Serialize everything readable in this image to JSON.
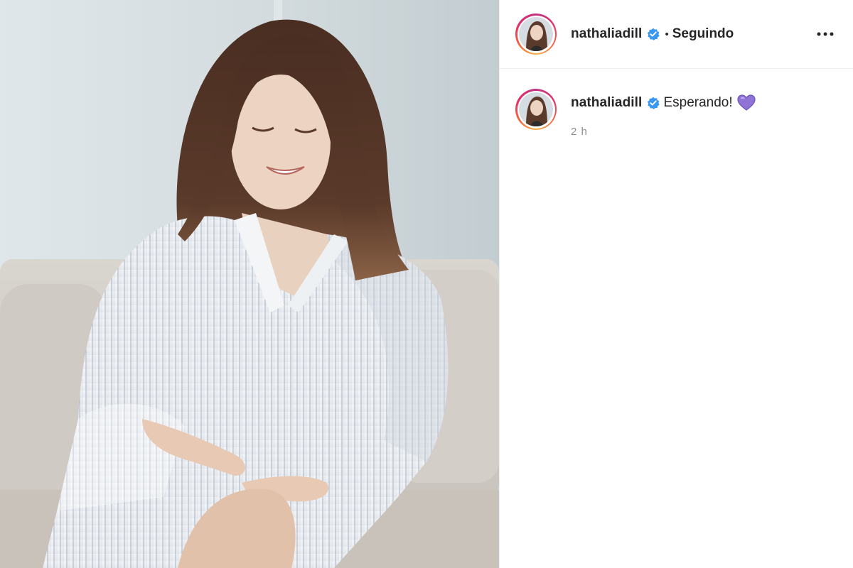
{
  "post": {
    "author": {
      "username": "nathaliadill",
      "verified": true,
      "follow_separator": "•",
      "follow_status": "Seguindo"
    },
    "caption": {
      "username": "nathaliadill",
      "text": "Esperando!",
      "emoji": "purple-heart",
      "timestamp": "2 h"
    },
    "icons": {
      "verified": "verified-badge-icon",
      "more": "more-options-icon"
    },
    "colors": {
      "verified_blue": "#3897f0",
      "heart_purple": "#8f74d6",
      "muted_text": "#8e8e8e"
    }
  }
}
